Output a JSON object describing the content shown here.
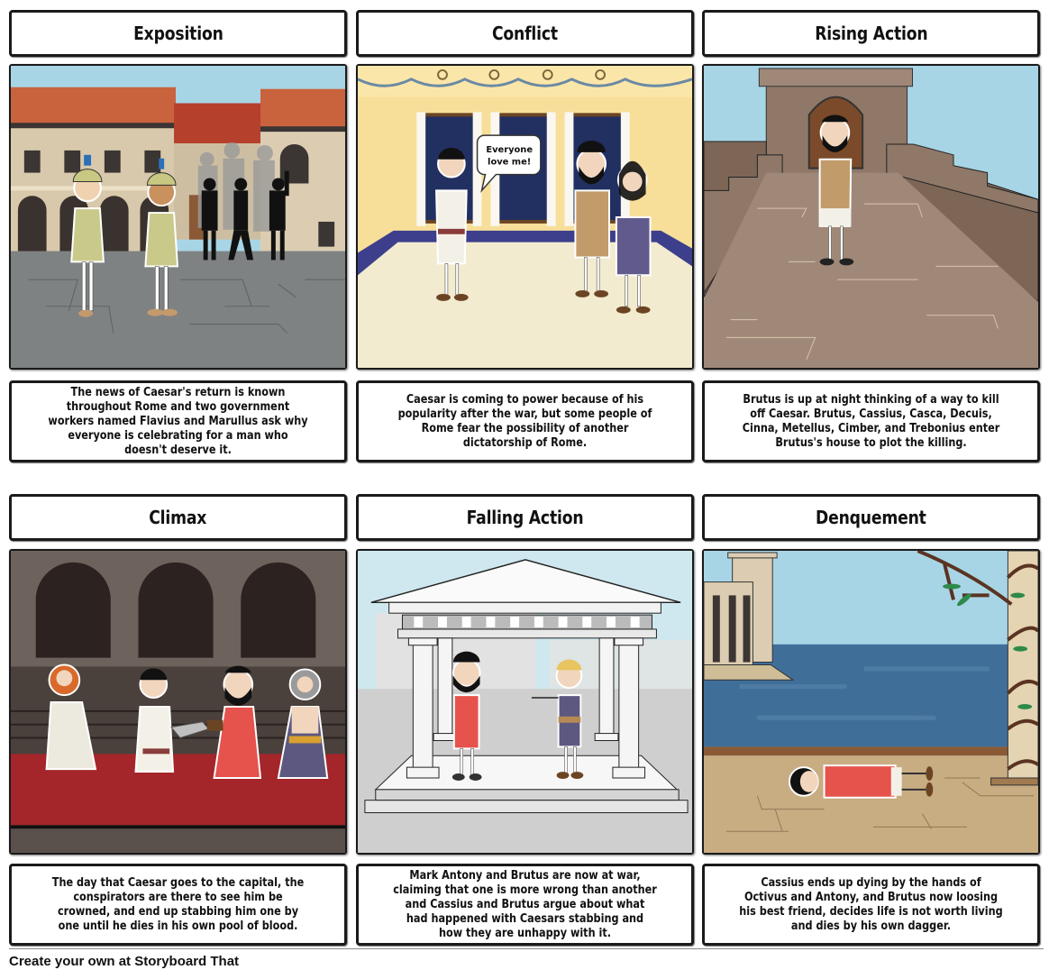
{
  "storyboard": {
    "cells": [
      {
        "title": "Exposition",
        "description": "The news of Caesar's return is known throughout Rome and two government workers named Flavius and Marullus ask why everyone is celebrating for a man who doesn't deserve it."
      },
      {
        "title": "Conflict",
        "description": "Caesar is coming to power because of his popularity after the war, but some people of Rome fear the possibility of another dictatorship of Rome.",
        "speech_bubble": [
          "Everyone",
          "love me!"
        ]
      },
      {
        "title": "Rising Action",
        "description": "Brutus is up at night thinking of a way to kill off Caesar. Brutus, Cassius, Casca, Decuis, Cinna, Metellus, Cimber, and Trebonius enter Brutus's house to plot the killing."
      },
      {
        "title": "Climax",
        "description": "The day that Caesar goes to the capital, the conspirators are there to see him be crowned, and end up stabbing him one by one until he dies in his own pool of blood."
      },
      {
        "title": "Falling Action",
        "description": "Mark Antony and Brutus are now at war, claiming that one is more wrong than another and Cassius and Brutus argue about what had happened with Caesars stabbing and how they are unhappy with it."
      },
      {
        "title": "Denquement",
        "description": "Cassius ends up dying by the hands of Octivus and Antony, and Brutus now loosing his best friend, decides life is not worth living and dies by his own dagger."
      }
    ]
  },
  "footer": {
    "text": "Create your own at Storyboard That"
  },
  "colors": {
    "border": "#1a1a1a",
    "sky": "#a8d5e6",
    "roof": "#c8633e",
    "plaza": "#7f8282",
    "palace_wall": "#f7df9a",
    "carpet_blue": "#3d3f8c",
    "rampart": "#8f7868",
    "climax_wall": "#5a4f4a",
    "red_carpet": "#a4262a",
    "temple": "#f2f2f2",
    "sea": "#3f6f99",
    "stone_floor": "#c8ac82"
  }
}
